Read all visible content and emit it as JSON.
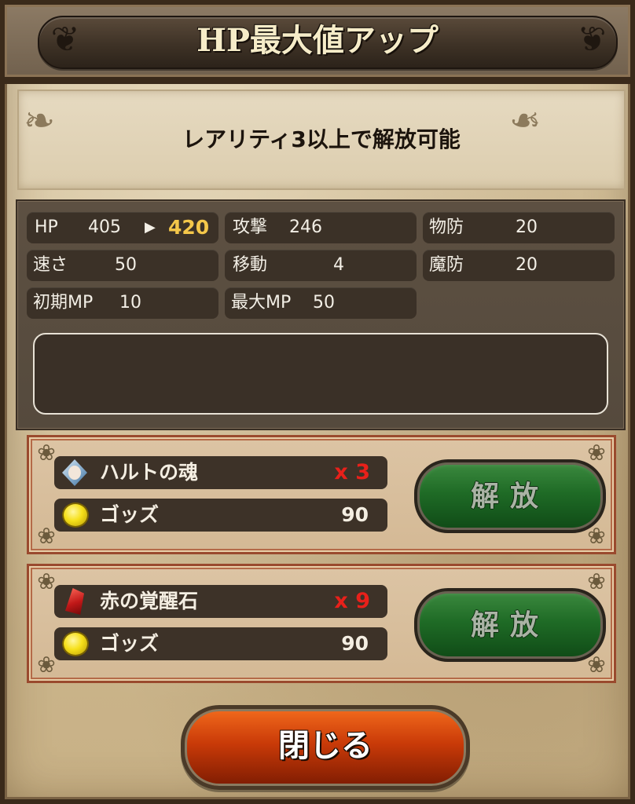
{
  "header": {
    "title": "HP最大値アップ"
  },
  "requirement": {
    "text": "レアリティ3以上で解放可能"
  },
  "stats": {
    "hp": {
      "label": "HP",
      "current": "405",
      "arrow": "▶",
      "new": "420"
    },
    "attack": {
      "label": "攻撃",
      "value": "246"
    },
    "phys_def": {
      "label": "物防",
      "value": "20"
    },
    "speed": {
      "label": "速さ",
      "value": "50"
    },
    "move": {
      "label": "移動",
      "value": "4"
    },
    "mag_def": {
      "label": "魔防",
      "value": "20"
    },
    "init_mp": {
      "label": "初期MP",
      "value": "10"
    },
    "max_mp": {
      "label": "最大MP",
      "value": "50"
    }
  },
  "description": {
    "text": ""
  },
  "options": [
    {
      "item_name": "ハルトの魂",
      "item_qty": "x 3",
      "item_icon": "soul-icon",
      "cost_name": "ゴッズ",
      "cost_value": "90",
      "button_label": "解放"
    },
    {
      "item_name": "赤の覚醒石",
      "item_qty": "x 9",
      "item_icon": "red-stone-icon",
      "cost_name": "ゴッズ",
      "cost_value": "90",
      "button_label": "解放"
    }
  ],
  "footer": {
    "close_label": "閉じる"
  },
  "colors": {
    "highlight_value": "#f4c74a",
    "quantity_red": "#e8201a",
    "release_green": "#1f6b26",
    "close_orange": "#c93a08"
  }
}
